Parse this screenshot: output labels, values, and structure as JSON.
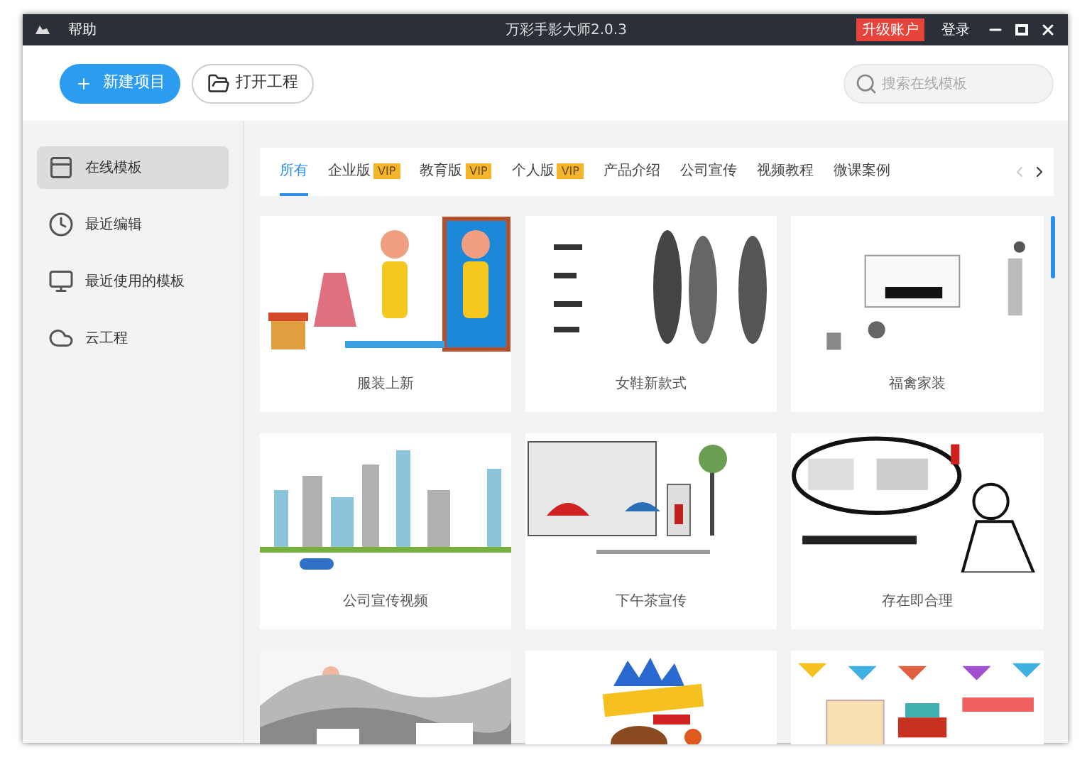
{
  "window": {
    "menu": "帮助",
    "title": "万彩手影大师2.0.3",
    "upgrade": "升级账户",
    "login": "登录"
  },
  "toolbar": {
    "new_button": "新建项目",
    "open_button": "打开工程",
    "search": {
      "placeholder": "搜索在线模板"
    }
  },
  "sidebar": {
    "items": [
      {
        "label": "在线模板",
        "kind": "template",
        "selected": true
      },
      {
        "label": "最近编辑",
        "kind": "clock",
        "selected": false
      },
      {
        "label": "最近使用的模板",
        "kind": "monitor",
        "selected": false
      },
      {
        "label": "云工程",
        "kind": "cloud",
        "selected": false
      }
    ]
  },
  "tabs": [
    {
      "label": "所有",
      "selected": true
    },
    {
      "label": "企业版",
      "badge": "VIP",
      "selected": false
    },
    {
      "label": "教育版",
      "badge": "VIP",
      "selected": false
    },
    {
      "label": "个人版",
      "badge": "VIP",
      "selected": false
    },
    {
      "label": "产品介绍",
      "selected": false
    },
    {
      "label": "公司宣传",
      "selected": false
    },
    {
      "label": "视频教程",
      "selected": false
    },
    {
      "label": "微课案例",
      "selected": false
    }
  ],
  "cards": [
    {
      "kind": "picture",
      "caption": "服装上新"
    },
    {
      "kind": "picture",
      "caption": "女鞋新款式"
    },
    {
      "kind": "picture",
      "caption": "福禽家装"
    },
    {
      "kind": "picture",
      "caption": "公司宣传视频"
    },
    {
      "kind": "picture",
      "caption": "下午茶宣传"
    },
    {
      "kind": "picture",
      "caption": "存在即合理"
    },
    {
      "kind": "picture"
    },
    {
      "kind": "picture"
    },
    {
      "kind": "picture"
    }
  ]
}
